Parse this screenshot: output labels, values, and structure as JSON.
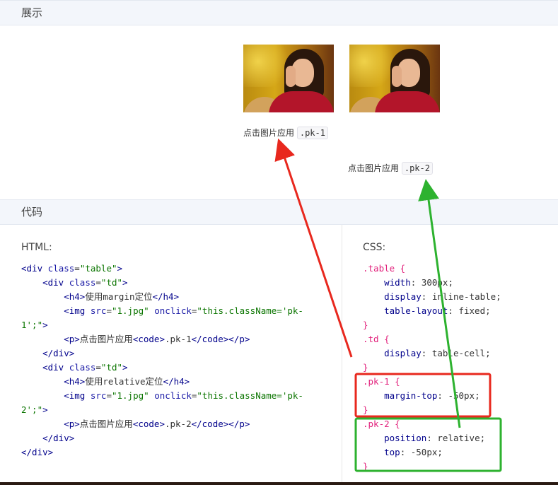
{
  "sections": {
    "show_title": "展示",
    "code_title": "代码"
  },
  "demo": {
    "caption_text": "点击图片应用",
    "pk1_code": ".pk-1",
    "pk2_code": ".pk-2"
  },
  "code": {
    "html_label": "HTML:",
    "css_label": "CSS:"
  },
  "colors": {
    "red_annotation": "#e8281e",
    "green_annotation": "#2db22f",
    "header_bg": "#f3f6fb"
  },
  "icons": {
    "photo": "portrait-photo-image"
  }
}
